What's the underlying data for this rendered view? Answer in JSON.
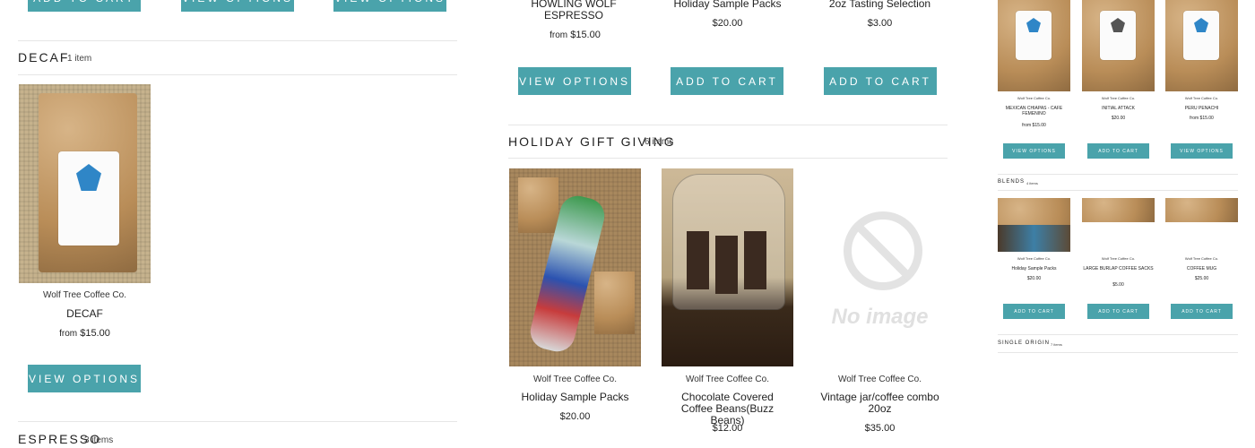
{
  "left": {
    "top_buttons": [
      "ADD TO CART",
      "VIEW OPTIONS",
      "VIEW OPTIONS"
    ],
    "decaf": {
      "title": "DECAF",
      "count": "1 item",
      "product": {
        "vendor": "Wolf Tree Coffee Co.",
        "name": "DECAF",
        "price_prefix": "from",
        "price": "$15.00",
        "button": "VIEW OPTIONS"
      }
    },
    "espresso": {
      "title": "ESPRESSO",
      "count": "3 items"
    }
  },
  "middle": {
    "top_products": [
      {
        "name": "HOWLING WOLF ESPRESSO",
        "price_prefix": "from",
        "price": "$15.00",
        "button": "VIEW OPTIONS"
      },
      {
        "name": "Holiday Sample Packs",
        "price": "$20.00",
        "button": "ADD TO CART"
      },
      {
        "name": "2oz Tasting Selection",
        "price": "$3.00",
        "button": "ADD TO CART"
      }
    ],
    "holiday": {
      "title": "HOLIDAY GIFT GIVING",
      "count": "6 items",
      "products": [
        {
          "vendor": "Wolf Tree Coffee Co.",
          "name": "Holiday Sample Packs",
          "price": "$20.00"
        },
        {
          "vendor": "Wolf Tree Coffee Co.",
          "name": "Chocolate Covered Coffee Beans(Buzz Beans)",
          "price": "$12.00"
        },
        {
          "vendor": "Wolf Tree Coffee Co.",
          "name": "Vintage jar/coffee combo 20oz",
          "price": "$35.00",
          "no_image_text": "No image"
        }
      ]
    }
  },
  "right": {
    "top_products": [
      {
        "vendor": "Wolf Tree Coffee Co.",
        "name": "MEXICAN CHIAPAS - CAFE FEMENINO",
        "price": "from $15.00",
        "button": "VIEW OPTIONS"
      },
      {
        "vendor": "Wolf Tree Coffee Co.",
        "name": "INITIAL ATTACK",
        "price": "$20.00",
        "button": "ADD TO CART"
      },
      {
        "vendor": "Wolf Tree Coffee Co.",
        "name": "PERU PENACHI",
        "price": "from $15.00",
        "button": "VIEW OPTIONS"
      }
    ],
    "blends": {
      "title": "BLENDS",
      "count": "4 items",
      "products": [
        {
          "vendor": "Wolf Tree Coffee Co.",
          "name": "Holiday Sample Packs",
          "price": "$20.00",
          "button": "ADD TO CART"
        },
        {
          "vendor": "Wolf Tree Coffee Co.",
          "name": "LARGE BURLAP COFFEE SACKS",
          "price": "$5.00",
          "button": "ADD TO CART"
        },
        {
          "vendor": "Wolf Tree Coffee Co.",
          "name": "COFFEE MUG",
          "price": "$25.00",
          "button": "ADD TO CART"
        }
      ]
    },
    "single_origin": {
      "title": "SINGLE ORIGIN",
      "count": "7 items"
    }
  },
  "colors": {
    "accent": "#4aa3ab",
    "rule": "#e6e6e6"
  }
}
